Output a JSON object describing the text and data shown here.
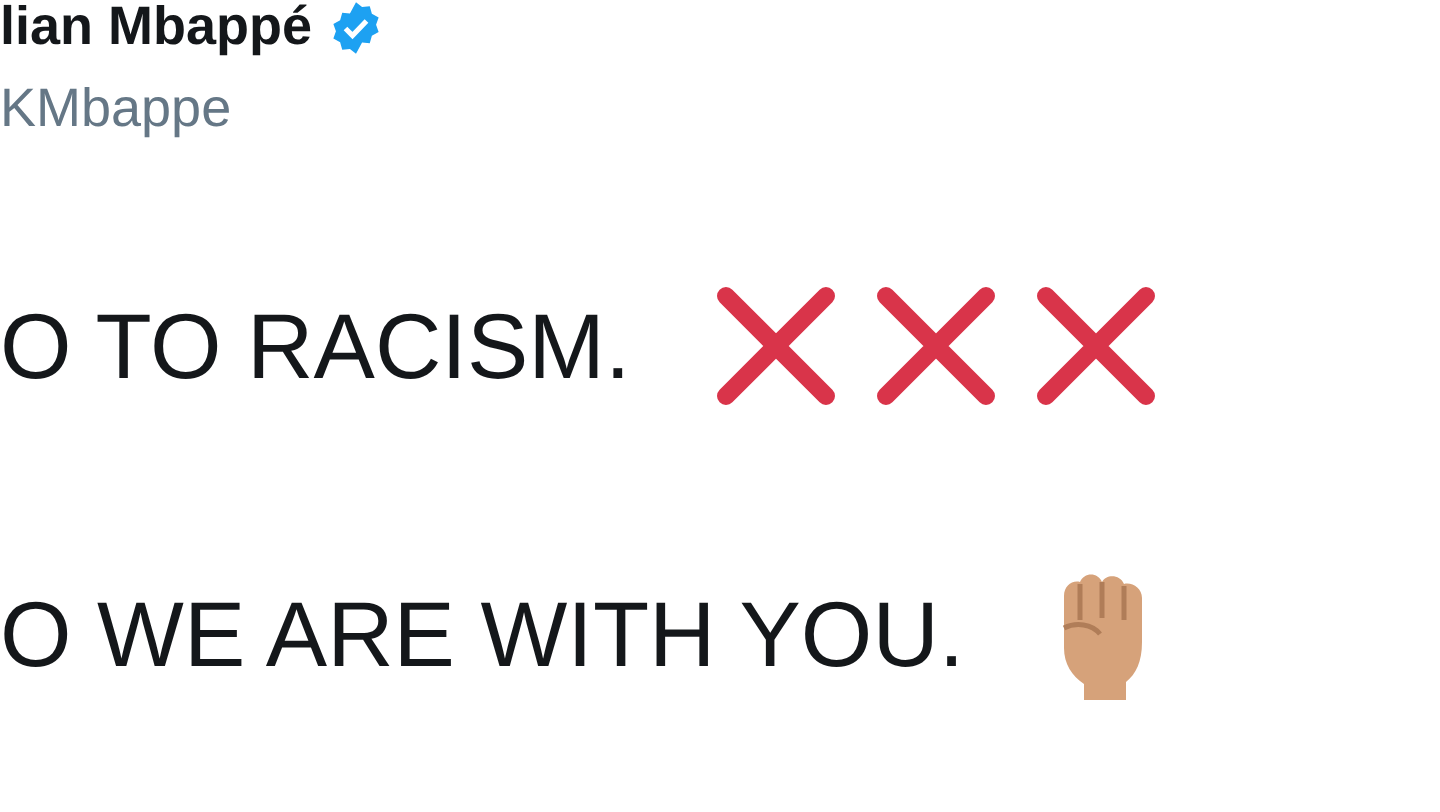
{
  "author": {
    "name": "lian Mbappé",
    "verified": true,
    "handle": "KMbappe"
  },
  "lines": [
    {
      "text": "O TO RACISM.",
      "icons": [
        {
          "kind": "cross"
        },
        {
          "kind": "cross"
        },
        {
          "kind": "cross"
        }
      ]
    },
    {
      "text": "O WE ARE WITH YOU.",
      "icons": [
        {
          "kind": "fist"
        }
      ]
    }
  ]
}
